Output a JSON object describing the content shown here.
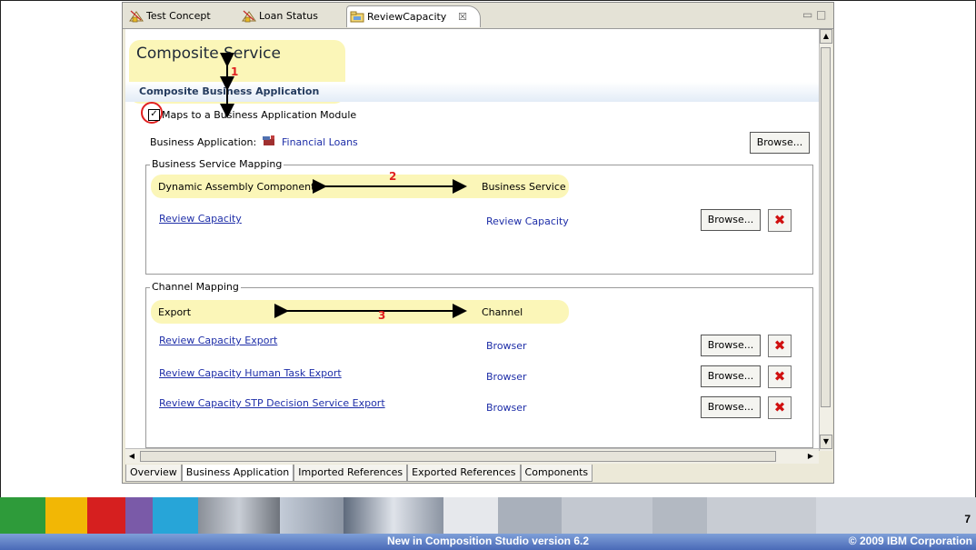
{
  "tabs": [
    {
      "label": "Test Concept",
      "icon": "concept-icon"
    },
    {
      "label": "Loan Status",
      "icon": "concept-icon"
    },
    {
      "label": "ReviewCapacity",
      "icon": "folder-icon",
      "close": "☒"
    }
  ],
  "window_controls": {
    "minimize": "▭",
    "maximize": "□"
  },
  "page": {
    "title": "Composite Service",
    "section": "Composite Business Application",
    "checkbox_label": "Maps to a Business Application Module",
    "checkbox_checked": true,
    "business_app_label": "Business Application:",
    "business_app_value": "Financial Loans",
    "browse_label": "Browse..."
  },
  "annotations": {
    "one": "1",
    "two": "2",
    "three": "3"
  },
  "business_service_mapping": {
    "title": "Business Service Mapping",
    "col_left": "Dynamic Assembly Component",
    "col_right": "Business Service",
    "rows": [
      {
        "component": "Review Capacity",
        "service": "Review Capacity",
        "browse": "Browse..."
      }
    ]
  },
  "channel_mapping": {
    "title": "Channel Mapping",
    "col_left": "Export",
    "col_right": "Channel",
    "rows": [
      {
        "export": "Review Capacity Export",
        "channel": "Browser",
        "browse": "Browse..."
      },
      {
        "export": "Review Capacity Human Task Export",
        "channel": "Browser",
        "browse": "Browse..."
      },
      {
        "export": "Review Capacity STP Decision Service Export",
        "channel": "Browser",
        "browse": "Browse..."
      }
    ]
  },
  "bottom_tabs": [
    "Overview",
    "Business Application",
    "Imported References",
    "Exported References",
    "Components"
  ],
  "footer": {
    "center": "New in Composition  Studio version 6.2",
    "copyright": "© 2009 IBM Corporation",
    "page_number": "7"
  },
  "colors": {
    "link": "#1e2ea8",
    "highlight": "#fbf6b8",
    "annotation": "#e02020",
    "footer_bar": "#4a6ab7"
  }
}
